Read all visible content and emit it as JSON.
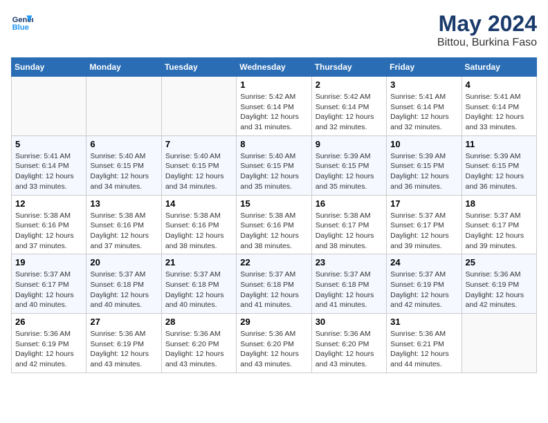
{
  "header": {
    "logo_line1": "General",
    "logo_line2": "Blue",
    "month": "May 2024",
    "location": "Bittou, Burkina Faso"
  },
  "days_of_week": [
    "Sunday",
    "Monday",
    "Tuesday",
    "Wednesday",
    "Thursday",
    "Friday",
    "Saturday"
  ],
  "weeks": [
    [
      {
        "day": "",
        "info": ""
      },
      {
        "day": "",
        "info": ""
      },
      {
        "day": "",
        "info": ""
      },
      {
        "day": "1",
        "info": "Sunrise: 5:42 AM\nSunset: 6:14 PM\nDaylight: 12 hours\nand 31 minutes."
      },
      {
        "day": "2",
        "info": "Sunrise: 5:42 AM\nSunset: 6:14 PM\nDaylight: 12 hours\nand 32 minutes."
      },
      {
        "day": "3",
        "info": "Sunrise: 5:41 AM\nSunset: 6:14 PM\nDaylight: 12 hours\nand 32 minutes."
      },
      {
        "day": "4",
        "info": "Sunrise: 5:41 AM\nSunset: 6:14 PM\nDaylight: 12 hours\nand 33 minutes."
      }
    ],
    [
      {
        "day": "5",
        "info": "Sunrise: 5:41 AM\nSunset: 6:14 PM\nDaylight: 12 hours\nand 33 minutes."
      },
      {
        "day": "6",
        "info": "Sunrise: 5:40 AM\nSunset: 6:15 PM\nDaylight: 12 hours\nand 34 minutes."
      },
      {
        "day": "7",
        "info": "Sunrise: 5:40 AM\nSunset: 6:15 PM\nDaylight: 12 hours\nand 34 minutes."
      },
      {
        "day": "8",
        "info": "Sunrise: 5:40 AM\nSunset: 6:15 PM\nDaylight: 12 hours\nand 35 minutes."
      },
      {
        "day": "9",
        "info": "Sunrise: 5:39 AM\nSunset: 6:15 PM\nDaylight: 12 hours\nand 35 minutes."
      },
      {
        "day": "10",
        "info": "Sunrise: 5:39 AM\nSunset: 6:15 PM\nDaylight: 12 hours\nand 36 minutes."
      },
      {
        "day": "11",
        "info": "Sunrise: 5:39 AM\nSunset: 6:15 PM\nDaylight: 12 hours\nand 36 minutes."
      }
    ],
    [
      {
        "day": "12",
        "info": "Sunrise: 5:38 AM\nSunset: 6:16 PM\nDaylight: 12 hours\nand 37 minutes."
      },
      {
        "day": "13",
        "info": "Sunrise: 5:38 AM\nSunset: 6:16 PM\nDaylight: 12 hours\nand 37 minutes."
      },
      {
        "day": "14",
        "info": "Sunrise: 5:38 AM\nSunset: 6:16 PM\nDaylight: 12 hours\nand 38 minutes."
      },
      {
        "day": "15",
        "info": "Sunrise: 5:38 AM\nSunset: 6:16 PM\nDaylight: 12 hours\nand 38 minutes."
      },
      {
        "day": "16",
        "info": "Sunrise: 5:38 AM\nSunset: 6:17 PM\nDaylight: 12 hours\nand 38 minutes."
      },
      {
        "day": "17",
        "info": "Sunrise: 5:37 AM\nSunset: 6:17 PM\nDaylight: 12 hours\nand 39 minutes."
      },
      {
        "day": "18",
        "info": "Sunrise: 5:37 AM\nSunset: 6:17 PM\nDaylight: 12 hours\nand 39 minutes."
      }
    ],
    [
      {
        "day": "19",
        "info": "Sunrise: 5:37 AM\nSunset: 6:17 PM\nDaylight: 12 hours\nand 40 minutes."
      },
      {
        "day": "20",
        "info": "Sunrise: 5:37 AM\nSunset: 6:18 PM\nDaylight: 12 hours\nand 40 minutes."
      },
      {
        "day": "21",
        "info": "Sunrise: 5:37 AM\nSunset: 6:18 PM\nDaylight: 12 hours\nand 40 minutes."
      },
      {
        "day": "22",
        "info": "Sunrise: 5:37 AM\nSunset: 6:18 PM\nDaylight: 12 hours\nand 41 minutes."
      },
      {
        "day": "23",
        "info": "Sunrise: 5:37 AM\nSunset: 6:18 PM\nDaylight: 12 hours\nand 41 minutes."
      },
      {
        "day": "24",
        "info": "Sunrise: 5:37 AM\nSunset: 6:19 PM\nDaylight: 12 hours\nand 42 minutes."
      },
      {
        "day": "25",
        "info": "Sunrise: 5:36 AM\nSunset: 6:19 PM\nDaylight: 12 hours\nand 42 minutes."
      }
    ],
    [
      {
        "day": "26",
        "info": "Sunrise: 5:36 AM\nSunset: 6:19 PM\nDaylight: 12 hours\nand 42 minutes."
      },
      {
        "day": "27",
        "info": "Sunrise: 5:36 AM\nSunset: 6:19 PM\nDaylight: 12 hours\nand 43 minutes."
      },
      {
        "day": "28",
        "info": "Sunrise: 5:36 AM\nSunset: 6:20 PM\nDaylight: 12 hours\nand 43 minutes."
      },
      {
        "day": "29",
        "info": "Sunrise: 5:36 AM\nSunset: 6:20 PM\nDaylight: 12 hours\nand 43 minutes."
      },
      {
        "day": "30",
        "info": "Sunrise: 5:36 AM\nSunset: 6:20 PM\nDaylight: 12 hours\nand 43 minutes."
      },
      {
        "day": "31",
        "info": "Sunrise: 5:36 AM\nSunset: 6:21 PM\nDaylight: 12 hours\nand 44 minutes."
      },
      {
        "day": "",
        "info": ""
      }
    ]
  ]
}
